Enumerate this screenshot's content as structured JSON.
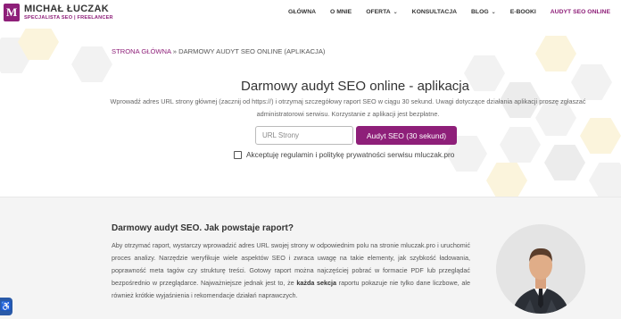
{
  "header": {
    "logo_name": "MICHAŁ ŁUCZAK",
    "logo_subtitle": "SPECJALISTA SEO | FREELANCER",
    "nav": [
      {
        "label": "GŁÓWNA"
      },
      {
        "label": "O MNIE"
      },
      {
        "label": "OFERTA"
      },
      {
        "label": "KONSULTACJA"
      },
      {
        "label": "BLOG"
      },
      {
        "label": "E-BOOKI"
      },
      {
        "label": "AUDYT SEO ONLINE"
      }
    ]
  },
  "breadcrumb": {
    "home": "STRONA GŁÓWNA",
    "separator": " » ",
    "current": "DARMOWY AUDYT SEO ONLINE (APLIKACJA)"
  },
  "tool": {
    "title": "Darmowy audyt SEO online - aplikacja",
    "description": "Wprowadź adres URL strony głównej (zacznij od https://) i otrzymaj szczegółowy raport SEO w ciągu 30 sekund. Uwagi dotyczące działania aplikacji proszę zgłaszać administratorowi serwisu. Korzystanie z aplikacji jest bezpłatne.",
    "url_placeholder": "URL Strony",
    "url_value": "",
    "submit_label": "Audyt SEO (30 sekund)",
    "consent_label": "Akceptuję regulamin i politykę prywatności serwisu mluczak.pro",
    "consent_checked": false
  },
  "info": {
    "title": "Darmowy audyt SEO. Jak powstaje raport?",
    "paragraph_before_bold": "Aby otrzymać raport, wystarczy wprowadzić adres URL swojej strony w odpowiednim polu na stronie mluczak.pro i uruchomić proces analizy. Narzędzie weryfikuje wiele aspektów SEO i zwraca uwagę na takie elementy, jak szybkość ładowania, poprawność meta tagów czy strukturę treści. Gotowy raport można najczęściej pobrać w formacie PDF lub przeglądać bezpośrednio w przeglądarce. Najważniejsze jednak jest to, że ",
    "bold": "każda sekcja",
    "paragraph_after_bold": " raportu pokazuje nie tylko dane liczbowe, ale również krótkie wyjaśnienia i rekomendacje działań naprawczych."
  },
  "icons": {
    "nav_dropdown": "chevron-down-icon",
    "accessibility": "accessibility-icon",
    "logo": "logo-mark-icon"
  },
  "colors": {
    "brand": "#8e1f79",
    "accessibility": "#2a5aa8"
  }
}
